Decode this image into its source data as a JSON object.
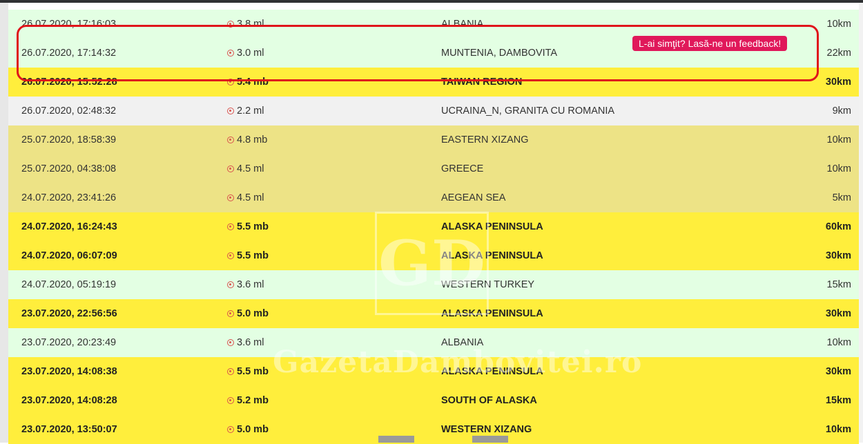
{
  "rows": [
    {
      "date": "26.07.2020, 17:16:03",
      "mag": "3.8 ml",
      "region": "ALBANIA",
      "depth": "10km",
      "style": "green",
      "bold": false
    },
    {
      "date": "26.07.2020, 17:14:32",
      "mag": "3.0 ml",
      "region": "MUNTENIA, DAMBOVITA",
      "depth": "22km",
      "style": "green",
      "bold": false
    },
    {
      "date": "26.07.2020, 15:52:28",
      "mag": "5.4 mb",
      "region": "TAIWAN REGION",
      "depth": "30km",
      "style": "yellow",
      "bold": true
    },
    {
      "date": "26.07.2020, 02:48:32",
      "mag": "2.2 ml",
      "region": "UCRAINA_N, GRANITA CU ROMANIA",
      "depth": "9km",
      "style": "grey",
      "bold": false
    },
    {
      "date": "25.07.2020, 18:58:39",
      "mag": "4.8 mb",
      "region": "EASTERN XIZANG",
      "depth": "10km",
      "style": "khaki",
      "bold": false
    },
    {
      "date": "25.07.2020, 04:38:08",
      "mag": "4.5 ml",
      "region": "GREECE",
      "depth": "10km",
      "style": "khaki",
      "bold": false
    },
    {
      "date": "24.07.2020, 23:41:26",
      "mag": "4.5 ml",
      "region": "AEGEAN SEA",
      "depth": "5km",
      "style": "khaki",
      "bold": false
    },
    {
      "date": "24.07.2020, 16:24:43",
      "mag": "5.5 mb",
      "region": "ALASKA PENINSULA",
      "depth": "60km",
      "style": "yellow",
      "bold": true
    },
    {
      "date": "24.07.2020, 06:07:09",
      "mag": "5.5 mb",
      "region": "ALASKA PENINSULA",
      "depth": "30km",
      "style": "yellow",
      "bold": true
    },
    {
      "date": "24.07.2020, 05:19:19",
      "mag": "3.6 ml",
      "region": "WESTERN TURKEY",
      "depth": "15km",
      "style": "green",
      "bold": false
    },
    {
      "date": "23.07.2020, 22:56:56",
      "mag": "5.0 mb",
      "region": "ALASKA PENINSULA",
      "depth": "30km",
      "style": "yellow",
      "bold": true
    },
    {
      "date": "23.07.2020, 20:23:49",
      "mag": "3.6 ml",
      "region": "ALBANIA",
      "depth": "10km",
      "style": "green",
      "bold": false
    },
    {
      "date": "23.07.2020, 14:08:38",
      "mag": "5.5 mb",
      "region": "ALASKA PENINSULA",
      "depth": "30km",
      "style": "yellow",
      "bold": true
    },
    {
      "date": "23.07.2020, 14:08:28",
      "mag": "5.2 mb",
      "region": "SOUTH OF ALASKA",
      "depth": "15km",
      "style": "yellow",
      "bold": true
    },
    {
      "date": "23.07.2020, 13:50:07",
      "mag": "5.0 mb",
      "region": "WESTERN XIZANG",
      "depth": "10km",
      "style": "yellow",
      "bold": true
    }
  ],
  "feedback_label": "L-ai simţit? Lasă-ne un feedback!",
  "watermark": {
    "logo": "GD",
    "site": "GazetaDambovitei.ro"
  },
  "colors": {
    "green": "#e3ffe3",
    "yellow": "#ffee3c",
    "grey": "#f1f1f1",
    "khaki": "#ede386",
    "feedback": "#e0185a",
    "highlight": "#e0141b"
  }
}
